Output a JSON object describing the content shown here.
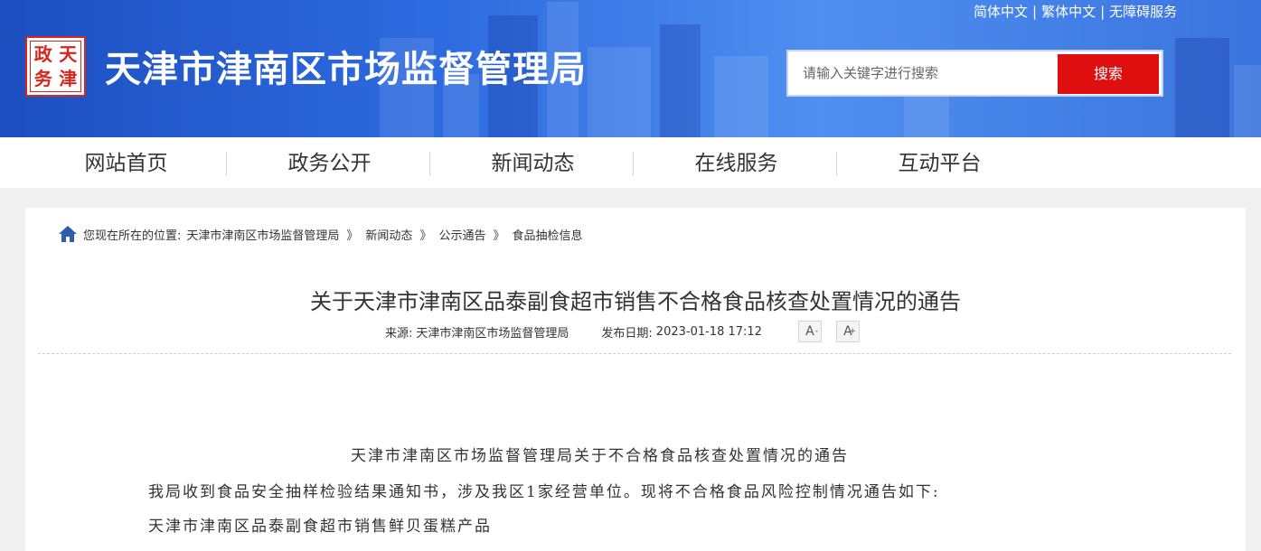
{
  "header": {
    "site_title": "天津市津南区市场监督管理局",
    "seal_chars": [
      "政",
      "天",
      "务",
      "津"
    ],
    "lang_links": [
      "简体中文",
      "繁体中文",
      "无障碍服务"
    ],
    "lang_separator": "|",
    "search_placeholder": "请输入关键字进行搜索",
    "search_button": "搜索",
    "accent_color": "#e00f0f"
  },
  "nav": {
    "items": [
      "网站首页",
      "政务公开",
      "新闻动态",
      "在线服务",
      "互动平台"
    ]
  },
  "breadcrumb": {
    "prefix": "您现在所在的位置:",
    "items": [
      "天津市津南区市场监督管理局",
      "新闻动态",
      "公示通告",
      "食品抽检信息"
    ],
    "separator": "》"
  },
  "article": {
    "title": "关于天津市津南区品泰副食超市销售不合格食品核查处置情况的通告",
    "source_label": "来源:",
    "source": "天津市津南区市场监督管理局",
    "date_label": "发布日期:",
    "date": "2023-01-18 17:12",
    "font_decrease": "A",
    "font_increase": "A",
    "font_decrease_sign": "-",
    "font_increase_sign": "+",
    "paragraphs": [
      "天津市津南区市场监督管理局关于不合格食品核查处置情况的通告",
      "我局收到食品安全抽样检验结果通知书，涉及我区1家经营单位。现将不合格食品风险控制情况通告如下:",
      "天津市津南区品泰副食超市销售鲜贝蛋糕产品"
    ]
  }
}
